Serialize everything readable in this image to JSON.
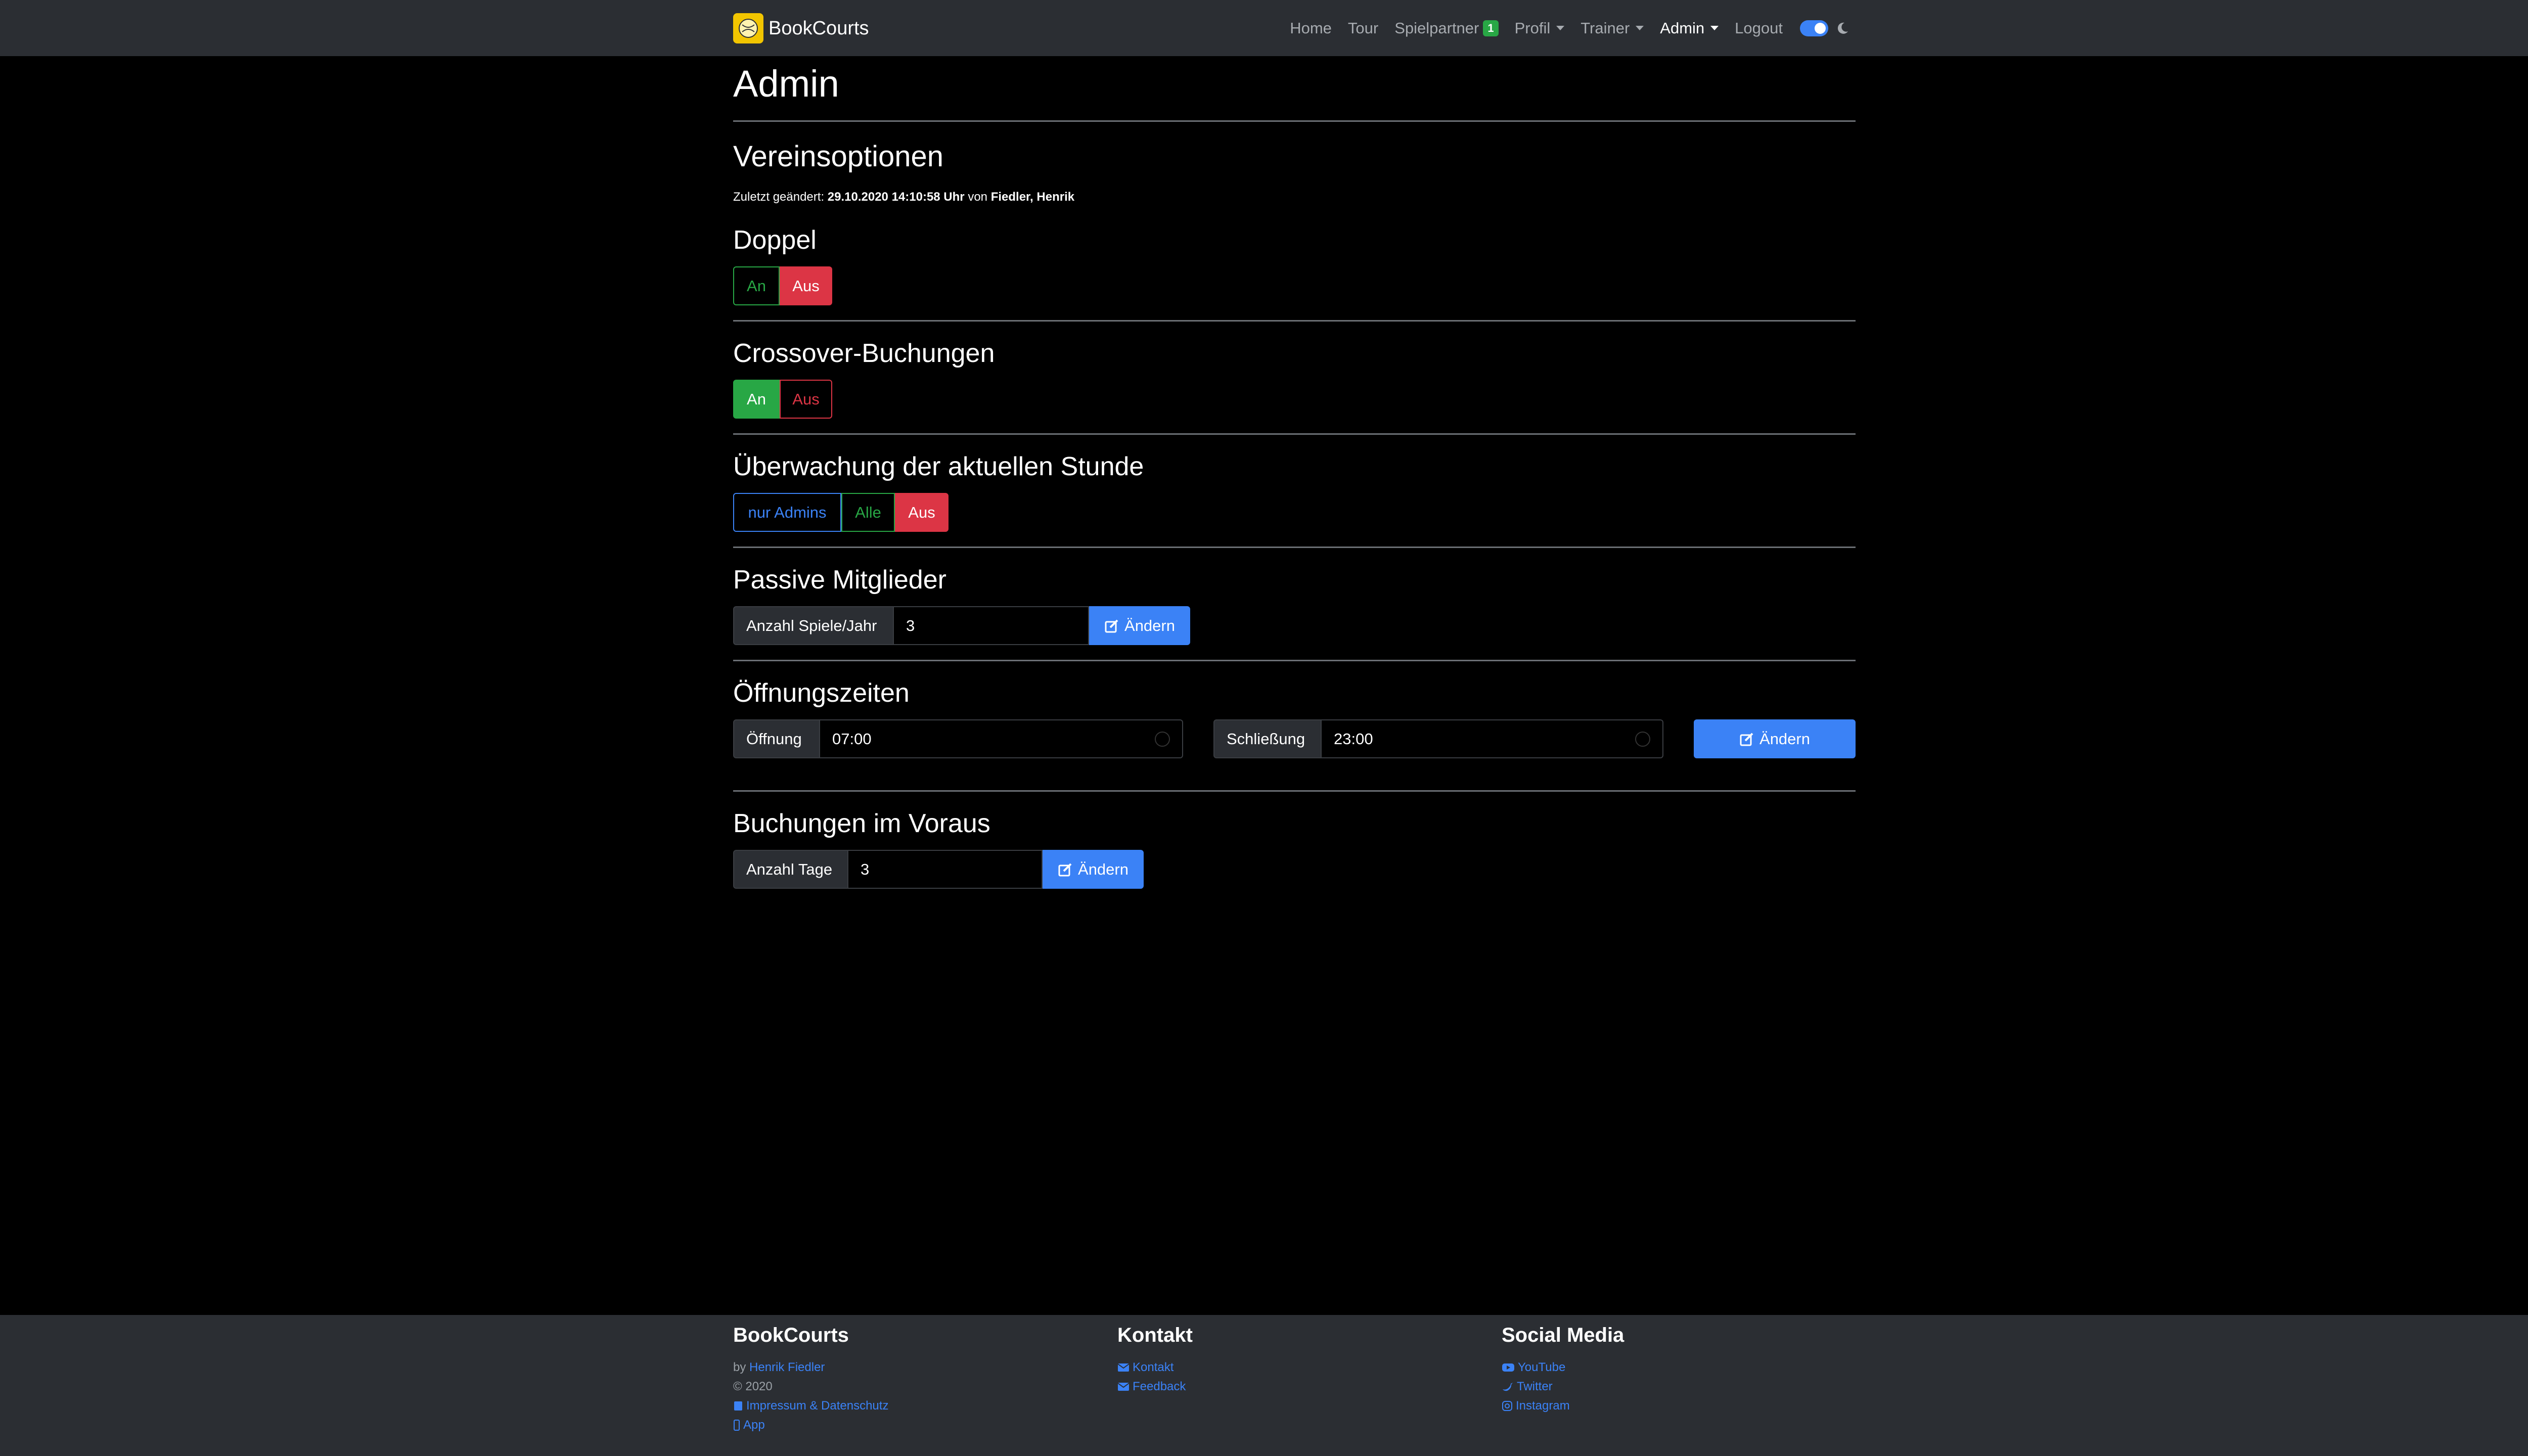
{
  "app": {
    "brand": "BookCourts"
  },
  "nav": {
    "home": "Home",
    "tour": "Tour",
    "spielpartner": "Spielpartner",
    "spielpartner_badge": "1",
    "profil": "Profil",
    "trainer": "Trainer",
    "admin": "Admin",
    "logout": "Logout"
  },
  "page": {
    "title": "Admin",
    "section": "Vereinsoptionen",
    "last_changed_label": "Zuletzt geändert:",
    "last_changed_value": "29.10.2020 14:10:58 Uhr",
    "by_label": "von",
    "by_value": "Fiedler, Henrik"
  },
  "doppel": {
    "title": "Doppel",
    "on": "An",
    "off": "Aus",
    "selected": "Aus"
  },
  "crossover": {
    "title": "Crossover-Buchungen",
    "on": "An",
    "off": "Aus",
    "selected": "An"
  },
  "monitoring": {
    "title": "Überwachung der aktuellen Stunde",
    "opt1": "nur Admins",
    "opt2": "Alle",
    "opt3": "Aus",
    "selected": "Aus"
  },
  "passive": {
    "title": "Passive Mitglieder",
    "label": "Anzahl Spiele/Jahr",
    "value": "3",
    "button": "Ändern"
  },
  "hours": {
    "title": "Öffnungszeiten",
    "open_label": "Öffnung",
    "open_value": "07:00",
    "close_label": "Schließung",
    "close_value": "23:00",
    "button": "Ändern"
  },
  "advance": {
    "title": "Buchungen im Voraus",
    "label": "Anzahl Tage",
    "value": "3",
    "button": "Ändern"
  },
  "footer": {
    "col1_title": "BookCourts",
    "by": "by",
    "author": "Henrik Fiedler",
    "copyright": "© 2020",
    "impressum": "Impressum & Datenschutz",
    "app": "App",
    "col2_title": "Kontakt",
    "kontakt": "Kontakt",
    "feedback": "Feedback",
    "col3_title": "Social Media",
    "youtube": "YouTube",
    "twitter": "Twitter",
    "instagram": "Instagram"
  },
  "colors": {
    "accent": "#3b82f6",
    "success": "#28a745",
    "danger": "#dc3545",
    "navbar": "#2b2e33"
  }
}
